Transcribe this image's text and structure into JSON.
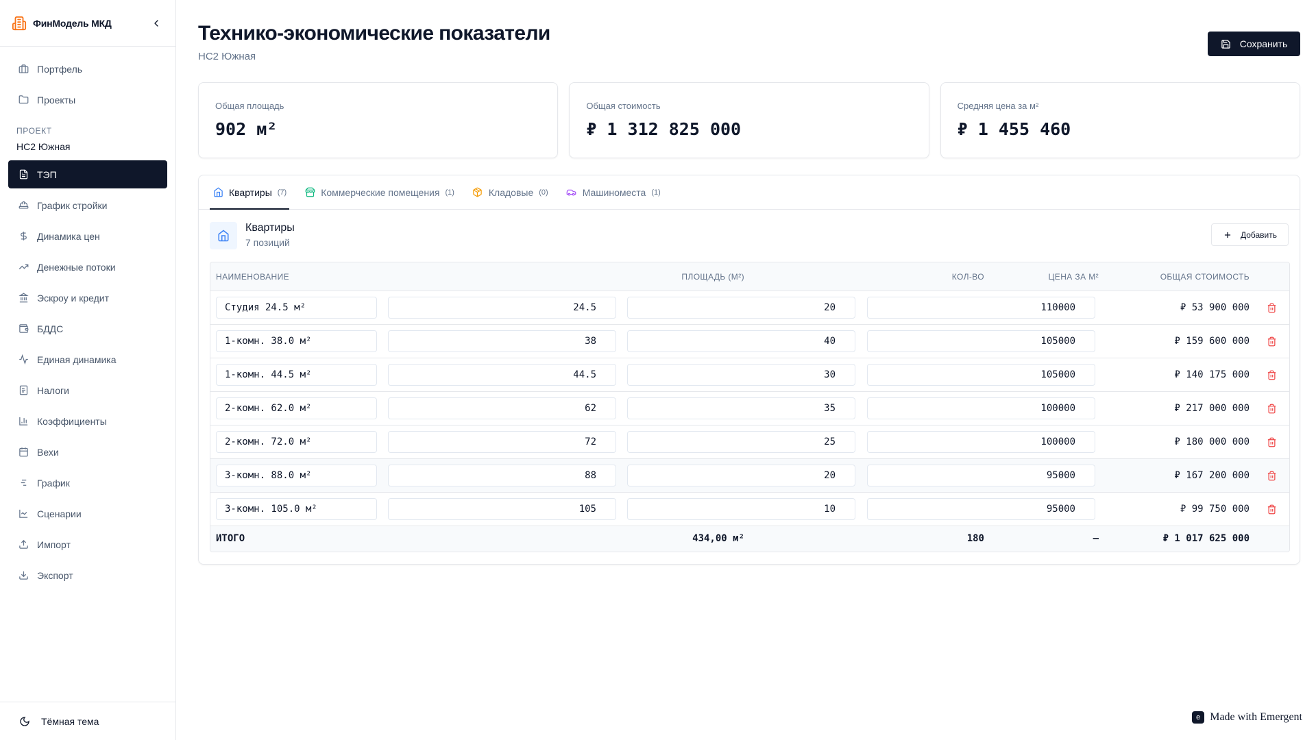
{
  "app": {
    "title": "ФинМодель МКД",
    "brand_color": "#f97316"
  },
  "sidebar": {
    "top_items": [
      {
        "label": "Портфель",
        "icon": "briefcase-icon"
      },
      {
        "label": "Проекты",
        "icon": "folder-icon"
      }
    ],
    "project_section_label": "ПРОЕКТ",
    "project_name": "НС2 Южная",
    "items": [
      {
        "label": "ТЭП",
        "icon": "file-text-icon",
        "active": true
      },
      {
        "label": "График стройки",
        "icon": "hard-hat-icon"
      },
      {
        "label": "Динамика цен",
        "icon": "dollar-icon"
      },
      {
        "label": "Денежные потоки",
        "icon": "trending-up-icon"
      },
      {
        "label": "Эскроу и кредит",
        "icon": "bank-icon"
      },
      {
        "label": "БДДС",
        "icon": "wallet-icon"
      },
      {
        "label": "Единая динамика",
        "icon": "activity-icon"
      },
      {
        "label": "Налоги",
        "icon": "receipt-icon"
      },
      {
        "label": "Коэффициенты",
        "icon": "bar-chart-icon"
      },
      {
        "label": "Вехи",
        "icon": "calendar-icon"
      },
      {
        "label": "График",
        "icon": "gantt-icon"
      },
      {
        "label": "Сценарии",
        "icon": "line-chart-icon"
      },
      {
        "label": "Импорт",
        "icon": "upload-icon"
      },
      {
        "label": "Экспорт",
        "icon": "download-icon"
      }
    ],
    "footer_label": "Тёмная тема"
  },
  "header": {
    "title": "Технико-экономические показатели",
    "subtitle": "НС2 Южная",
    "save_label": "Сохранить"
  },
  "stats": [
    {
      "label": "Общая площадь",
      "value": "902 м²"
    },
    {
      "label": "Общая стоимость",
      "value": "₽ 1 312 825 000"
    },
    {
      "label": "Средняя цена за м²",
      "value": "₽ 1 455 460"
    }
  ],
  "tabs": [
    {
      "label": "Квартиры",
      "count": "(7)",
      "icon": "home-icon",
      "icon_color": "#3b82f6",
      "active": true
    },
    {
      "label": "Коммерческие помещения",
      "count": "(1)",
      "icon": "store-icon",
      "icon_color": "#10b981"
    },
    {
      "label": "Кладовые",
      "count": "(0)",
      "icon": "package-icon",
      "icon_color": "#f59e0b"
    },
    {
      "label": "Машиноместа",
      "count": "(1)",
      "icon": "car-icon",
      "icon_color": "#a855f7"
    }
  ],
  "section": {
    "title": "Квартиры",
    "subtitle": "7 позиций",
    "add_label": "Добавить"
  },
  "table": {
    "headers": {
      "name": "НАИМЕНОВАНИЕ",
      "area": "ПЛОЩАДЬ (М²)",
      "qty": "КОЛ-ВО",
      "price": "ЦЕНА ЗА М²",
      "total": "ОБЩАЯ СТОИМОСТЬ"
    },
    "rows": [
      {
        "name": "Студия 24.5 м²",
        "area": "24.5",
        "qty": "20",
        "price": "110000",
        "total": "₽ 53 900 000"
      },
      {
        "name": "1-комн. 38.0 м²",
        "area": "38",
        "qty": "40",
        "price": "105000",
        "total": "₽ 159 600 000"
      },
      {
        "name": "1-комн. 44.5 м²",
        "area": "44.5",
        "qty": "30",
        "price": "105000",
        "total": "₽ 140 175 000"
      },
      {
        "name": "2-комн. 62.0 м²",
        "area": "62",
        "qty": "35",
        "price": "100000",
        "total": "₽ 217 000 000"
      },
      {
        "name": "2-комн. 72.0 м²",
        "area": "72",
        "qty": "25",
        "price": "100000",
        "total": "₽ 180 000 000"
      },
      {
        "name": "3-комн. 88.0 м²",
        "area": "88",
        "qty": "20",
        "price": "95000",
        "total": "₽ 167 200 000"
      },
      {
        "name": "3-комн. 105.0 м²",
        "area": "105",
        "qty": "10",
        "price": "95000",
        "total": "₽ 99 750 000"
      }
    ],
    "footer": {
      "label": "ИТОГО",
      "area": "434,00 м²",
      "qty": "180",
      "price": "—",
      "total": "₽ 1 017 625 000"
    }
  },
  "badge": {
    "label": "Made with Emergent"
  },
  "colors": {
    "primary": "#0f172a",
    "muted": "#64748b",
    "danger": "#ef4444",
    "border": "#e5e7eb"
  }
}
